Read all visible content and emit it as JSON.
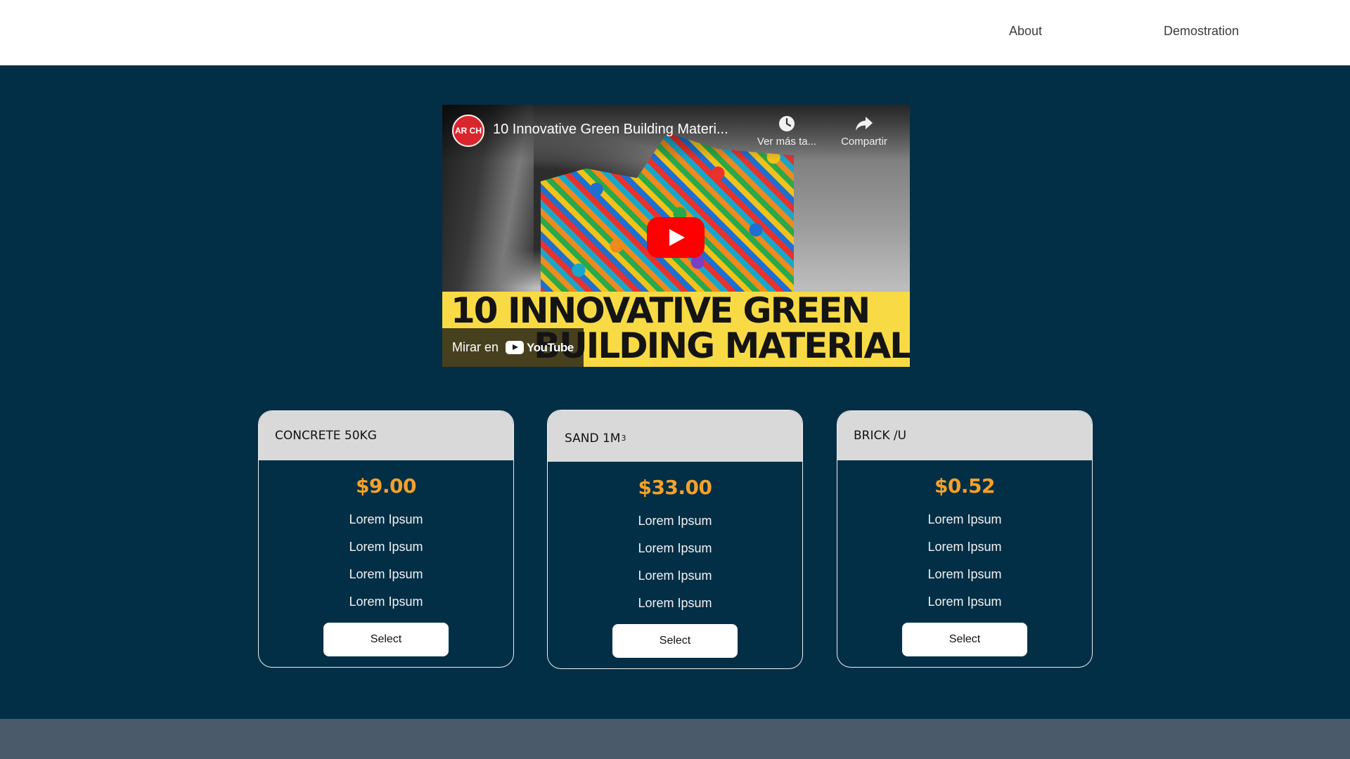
{
  "nav": {
    "about": "About",
    "demonstration": "Demostration"
  },
  "video": {
    "channel_avatar": "AR CH",
    "title": "10 Innovative Green Building Materi...",
    "watch_later_label": "Ver más ta...",
    "share_label": "Compartir",
    "thumbnail_line1": "10 INNOVATIVE GREEN",
    "thumbnail_line2": "BUILDING MATERIALS",
    "watch_on_label": "Mirar en",
    "youtube_brand": "YouTube"
  },
  "cards": [
    {
      "name": "CONCRETE 50KG",
      "price": "$9.00",
      "features": [
        "Lorem Ipsum",
        "Lorem Ipsum",
        "Lorem Ipsum",
        "Lorem Ipsum"
      ],
      "button": "Select"
    },
    {
      "name": "SAND 1M",
      "name_superscript": "3",
      "price": "$33.00",
      "features": [
        "Lorem Ipsum",
        "Lorem Ipsum",
        "Lorem Ipsum",
        "Lorem Ipsum"
      ],
      "button": "Select"
    },
    {
      "name": "BRICK /U",
      "price": "$0.52",
      "features": [
        "Lorem Ipsum",
        "Lorem Ipsum",
        "Lorem Ipsum",
        "Lorem Ipsum"
      ],
      "button": "Select"
    }
  ],
  "colors": {
    "background": "#032f46",
    "header": "#ffffff",
    "card_header": "#d9d9d9",
    "price": "#f5a12a",
    "footer": "#4a5a6a",
    "thumbnail_banner": "#f8da45",
    "play_button": "#ff0000"
  }
}
